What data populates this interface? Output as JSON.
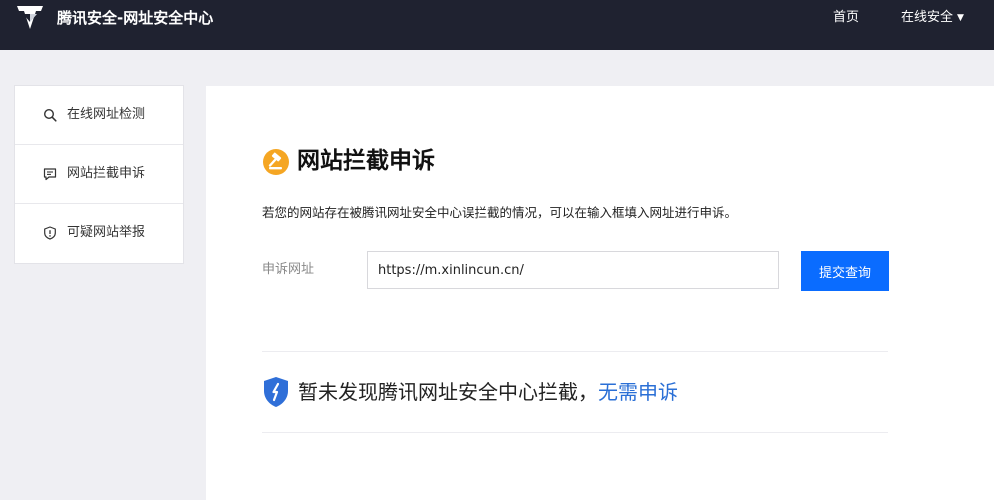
{
  "header": {
    "brand": "腾讯安全-网址安全中心",
    "nav": {
      "home": "首页",
      "online_security": "在线安全"
    },
    "icons": {
      "logo": "tencent-security-logo",
      "caret": "caret-down-icon"
    }
  },
  "sidebar": {
    "items": [
      {
        "label": "在线网址检测",
        "icon": "search-icon"
      },
      {
        "label": "网站拦截申诉",
        "icon": "chat-icon"
      },
      {
        "label": "可疑网站举报",
        "icon": "shield-alert-icon"
      }
    ]
  },
  "main": {
    "title": "网站拦截申诉",
    "title_icon": "gavel-icon",
    "description": "若您的网站存在被腾讯网址安全中心误拦截的情况，可以在输入框填入网址进行申诉。",
    "form": {
      "label": "申诉网址",
      "url_value": "https://m.xinlincun.cn/",
      "submit_label": "提交查询"
    },
    "result": {
      "icon": "shield-check-icon",
      "text": "暂未发现腾讯网址安全中心拦截，",
      "link": "无需申诉"
    }
  },
  "colors": {
    "header_bg": "#1f2230",
    "accent": "#0a6cff",
    "link": "#2a6fd6",
    "title_icon": "#f5a623",
    "page_bg": "#efeff3"
  }
}
